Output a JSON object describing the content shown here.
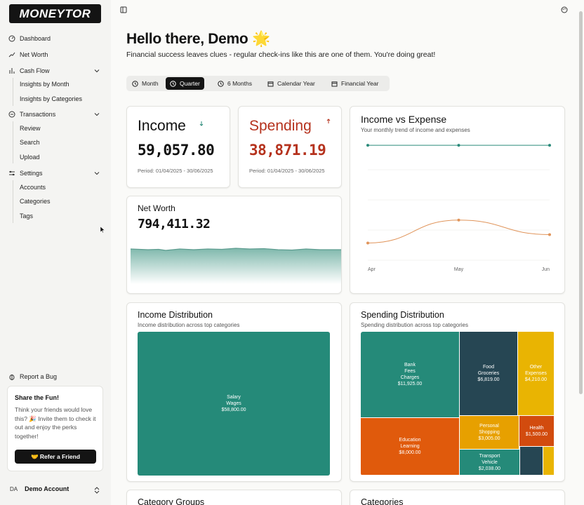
{
  "app": {
    "logo": "MONEYTOR"
  },
  "sidebar": {
    "dashboard": "Dashboard",
    "net_worth": "Net Worth",
    "cash_flow": "Cash Flow",
    "cash_flow_items": [
      "Insights by Month",
      "Insights by Categories"
    ],
    "transactions": "Transactions",
    "transactions_items": [
      "Review",
      "Search",
      "Upload"
    ],
    "settings": "Settings",
    "settings_items": [
      "Accounts",
      "Categories",
      "Tags"
    ],
    "report_bug": "Report a Bug",
    "share": {
      "title": "Share the Fun!",
      "text": "Think your friends would love this? 🎉 Invite them to check it out and enjoy the perks together!",
      "button": "🤝 Refer a Friend"
    },
    "account": {
      "initials": "DA",
      "name": "Demo Account"
    }
  },
  "header": {
    "greeting": "Hello there, Demo 🌟",
    "subtitle": "Financial success leaves clues - regular check-ins like this are one of them. You're doing great!"
  },
  "periods": [
    "Month",
    "Quarter",
    "6 Months",
    "Calendar Year",
    "Financial Year"
  ],
  "active_period": "Quarter",
  "income": {
    "title": "Income",
    "value": "59,057.80",
    "period": "Period: 01/04/2025 - 30/06/2025",
    "trend": "down"
  },
  "spending": {
    "title": "Spending",
    "value": "38,871.19",
    "period": "Period: 01/04/2025 - 30/06/2025",
    "trend": "up"
  },
  "net_worth": {
    "title": "Net Worth",
    "value": "794,411.32"
  },
  "income_vs_expense": {
    "title": "Income vs Expense",
    "subtitle": "Your monthly trend of income and expenses"
  },
  "chart_data": {
    "type": "line",
    "title": "Income vs Expense",
    "categories": [
      "Apr",
      "May",
      "Jun"
    ],
    "series": [
      {
        "values": [
          19700,
          19700,
          19700
        ],
        "color": "#2a8a7a"
      },
      {
        "values": [
          11600,
          13500,
          12300
        ],
        "color": "#e0945a"
      }
    ]
  },
  "income_distribution": {
    "title": "Income Distribution",
    "subtitle": "Income distribution across top categories",
    "items": [
      {
        "label": "Salary\nWages",
        "value": "$58,800.00",
        "amount": 58800,
        "color": "#258a79"
      }
    ]
  },
  "spending_distribution": {
    "title": "Spending Distribution",
    "subtitle": "Spending distribution across top categories",
    "items": [
      {
        "label": "Bank\nFees\nCharges",
        "value": "$11,925.00",
        "amount": 11925,
        "color": "#258a79"
      },
      {
        "label": "Food\nGroceries",
        "value": "$6,819.00",
        "amount": 6819,
        "color": "#264653"
      },
      {
        "label": "Other\nExpenses",
        "value": "$4,210.00",
        "amount": 4210,
        "color": "#e9b402"
      },
      {
        "label": "Education\nLearning",
        "value": "$8,000.00",
        "amount": 8000,
        "color": "#e05a0c"
      },
      {
        "label": "Personal\nShopping",
        "value": "$3,005.00",
        "amount": 3005,
        "color": "#e7a000"
      },
      {
        "label": "Health",
        "value": "$1,500.00",
        "amount": 1500,
        "color": "#d24b0e"
      },
      {
        "label": "Transport\nVehicle",
        "value": "$2,038.00",
        "amount": 2038,
        "color": "#258a79"
      },
      {
        "label": "",
        "value": "",
        "amount": 1500,
        "color": "#264653"
      },
      {
        "label": "",
        "value": "",
        "amount": 500,
        "color": "#e9b402"
      }
    ]
  },
  "bottom": {
    "left_title": "Category Groups",
    "right_title": "Categories"
  }
}
